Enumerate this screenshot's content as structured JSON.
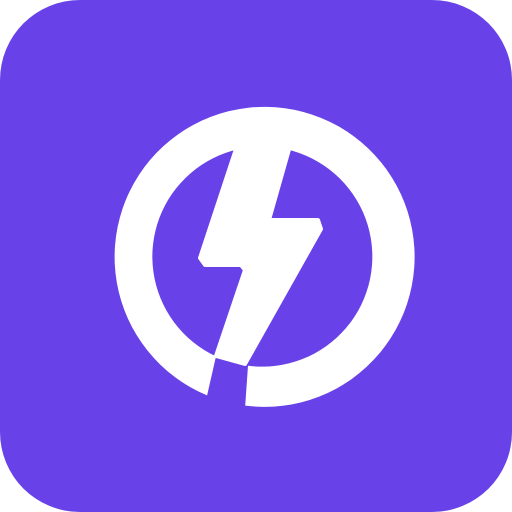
{
  "icon": {
    "name": "lightning-bolt-app-icon",
    "glyph": "lightning-bolt-icon",
    "emblem": "ring-icon"
  },
  "colors": {
    "tile_background": "#6842E8",
    "foreground": "#FFFFFF",
    "page_background": "#FFFFFF"
  }
}
